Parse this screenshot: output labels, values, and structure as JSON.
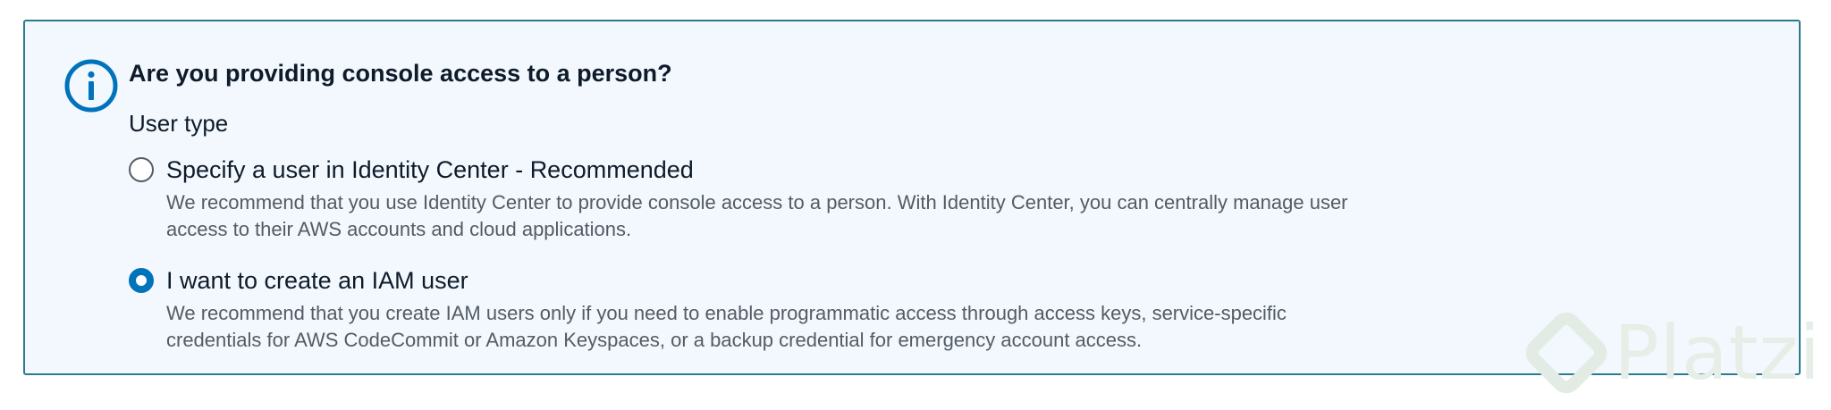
{
  "panel": {
    "heading": "Are you providing console access to a person?",
    "field_label": "User type",
    "options": [
      {
        "title": "Specify a user in Identity Center - Recommended",
        "description": "We recommend that you use Identity Center to provide console access to a person. With Identity Center, you can centrally manage user access to their AWS accounts and cloud applications.",
        "selected": false
      },
      {
        "title": "I want to create an IAM user",
        "description": "We recommend that you create IAM users only if you need to enable programmatic access through access keys, service-specific credentials for AWS CodeCommit or Amazon Keyspaces, or a backup credential for emergency account access.",
        "selected": true
      }
    ]
  },
  "watermark": {
    "text": "Platzi"
  },
  "colors": {
    "panel_background": "#f2f8fd",
    "panel_border": "#2b7a8f",
    "info_icon": "#0073bb",
    "radio_selected": "#0073bb",
    "text_primary": "#0f1b2a",
    "text_secondary": "#545b64"
  },
  "icons": {
    "info": "info-circle-icon",
    "watermark_logo": "platzi-logo-icon"
  }
}
